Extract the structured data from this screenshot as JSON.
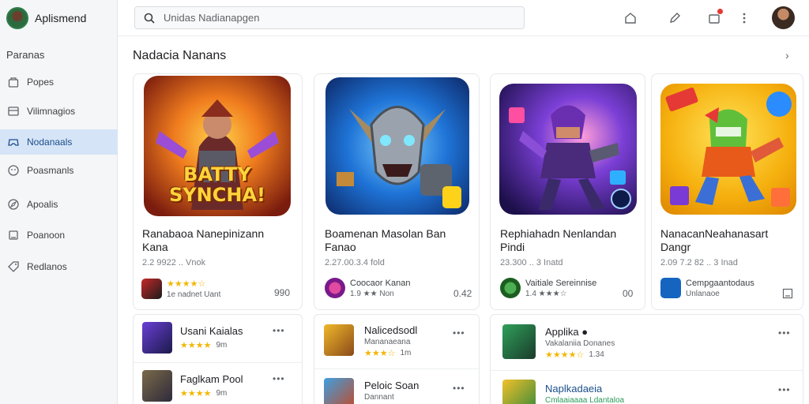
{
  "app": {
    "title": "Aplismend"
  },
  "sidebar": {
    "heading": "Paranas",
    "items": [
      {
        "label": "Popes",
        "icon": "home-icon"
      },
      {
        "label": "Vilimnagios",
        "icon": "grid-icon"
      },
      {
        "label": "Nodanaals",
        "icon": "gamepad-icon",
        "active": true
      },
      {
        "label": "Poasmanls",
        "icon": "face-icon"
      },
      {
        "label": "Apoalis",
        "icon": "compass-icon"
      },
      {
        "label": "Poanoon",
        "icon": "square-icon"
      },
      {
        "label": "Redlanos",
        "icon": "tag-icon"
      }
    ]
  },
  "search": {
    "placeholder": "Unidas Nadianapgen"
  },
  "section": {
    "title": "Nadacia Nanans",
    "more": "›"
  },
  "cards": [
    {
      "art_text": "BATTY SYNCHA!",
      "title_line1": "Ranabaoa Nanepinizann",
      "title_line2": "Kana",
      "meta": "2.2 9922 .. Vnok",
      "dev_name": "",
      "dev_sub": "1e nadnet Uant",
      "stars": "★★★★☆",
      "right": "990"
    },
    {
      "art_text": "",
      "title_line1": "Boamenan Masolan Ban",
      "title_line2": "Fanao",
      "meta": "2.27.00.3.4 fold",
      "dev_name": "Coocaor Kanan",
      "dev_sub": "1.9 ★★ Non",
      "stars": "",
      "right": "0.42"
    },
    {
      "art_text": "",
      "title_line1": "Rephiahadn Nenlandan",
      "title_line2": "Pindi",
      "meta": "23.300 .. 3 Inatd",
      "dev_name": "Vaitiale Sereinnise",
      "dev_sub": "1.4 ★★★☆",
      "stars": "",
      "right": "00"
    },
    {
      "art_text": "",
      "title_line1": "NanacanNeahanasart",
      "title_line2": "Dangr",
      "meta": "2.09 7.2 82 .. 3 Inad",
      "dev_name": "Cempgaantodaus",
      "dev_sub": "Unlanaoe",
      "stars": "",
      "right": ""
    }
  ],
  "lists": [
    [
      {
        "title": "Usani Kaialas",
        "stars": "★★★★",
        "meta": "9m"
      },
      {
        "title": "Faglkam Pool",
        "stars": "★★★★",
        "meta": "9m"
      }
    ],
    [
      {
        "title": "Nalicedsodl",
        "sub": "Mananaeana",
        "stars": "★★★☆",
        "meta": "1m"
      },
      {
        "title": "Peloic Soan",
        "sub": "Dannant",
        "stars": "",
        "meta": ""
      }
    ],
    [
      {
        "title": "Applika ●",
        "sub": "Vakalaniia Donanes",
        "stars": "★★★★☆",
        "meta": "1.34"
      },
      {
        "title": "Naplkadaeia",
        "sub": "Cmlaaiaaaa Ldantaloa",
        "stars": "",
        "meta": ""
      }
    ]
  ],
  "colors": {
    "accent": "#1a73e8",
    "active_bg": "#d6e4f7",
    "star": "#f2b705",
    "badge": "#e53935"
  }
}
